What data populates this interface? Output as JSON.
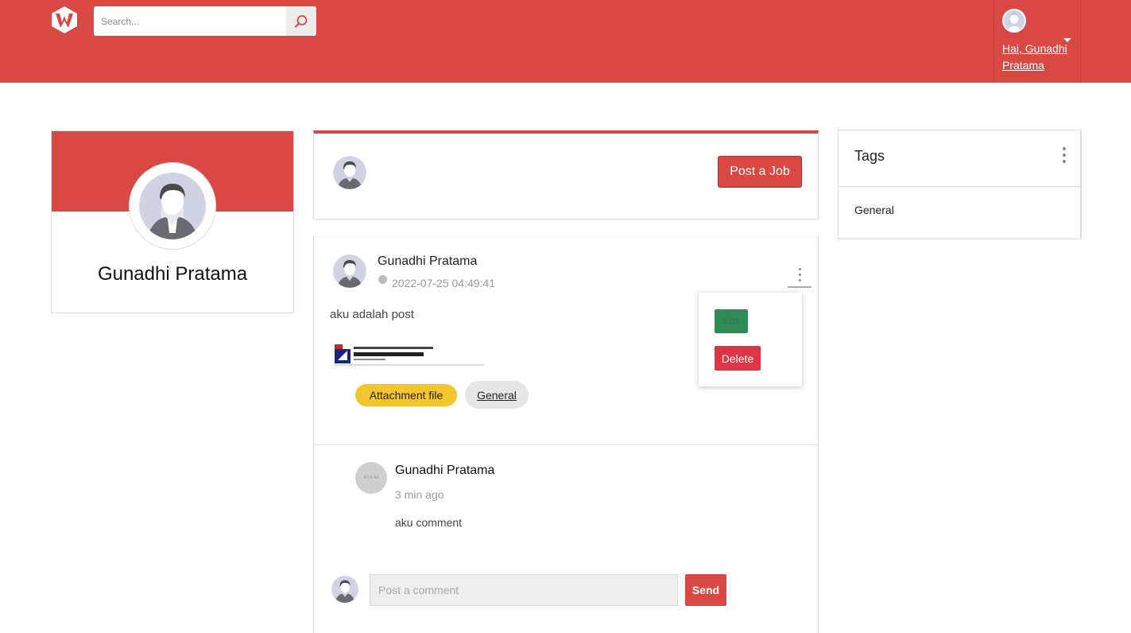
{
  "header": {
    "logo_icon": "w-logo-icon",
    "search": {
      "placeholder": "Search...",
      "value": ""
    },
    "search_icon": "search-icon",
    "user_greeting": "Hai, Gunadhi Pratama"
  },
  "profile": {
    "name": "Gunadhi Pratama"
  },
  "compose": {
    "post_job_label": "Post a Job"
  },
  "post": {
    "author": "Gunadhi Pratama",
    "timestamp": "2022-07-25 04:49:41",
    "text": "aku adalah post",
    "attachment_label": "Attachment file",
    "tag_label": "General",
    "menu": {
      "edit_label": "Edit",
      "delete_label": "Delete"
    },
    "comment": {
      "avatar_placeholder": "40 x 40",
      "author": "Gunadhi Pratama",
      "time": "3 min ago",
      "text": "aku comment"
    },
    "reply": {
      "placeholder": "Post a comment",
      "value": "",
      "send_label": "Send"
    }
  },
  "tags": {
    "title": "Tags",
    "items": [
      "General"
    ]
  },
  "colors": {
    "brand": "#d94842",
    "attachment": "#f4c52c",
    "edit": "#2e8a57",
    "delete": "#dc3545"
  }
}
